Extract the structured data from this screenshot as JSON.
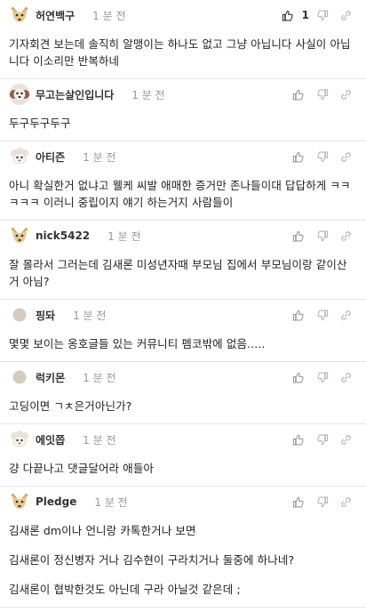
{
  "comments": [
    {
      "nickname": "허연백구",
      "avatar_icon": "dog-face-icon",
      "time": "1 분 전",
      "likes": "1",
      "lines": [
        "기자회견 보는데 솔직히 알맹이는 하나도 없고 그냥 아닙니다 사실이 아닙니다 이소리만 반복하네"
      ]
    },
    {
      "nickname": "무고는살인입니다",
      "avatar_icon": "poodle-face-icon",
      "time": "1 분 전",
      "likes": "",
      "lines": [
        "두구두구두구"
      ]
    },
    {
      "nickname": "아티즌",
      "avatar_icon": "sheep-face-icon",
      "time": "1 분 전",
      "likes": "",
      "lines": [
        "아니 확실한거 없냐고 웰케 씨발 애매한 증거만 존나들이대 답답하게 ㅋㅋㅋㅋㅋ 이러니 중립이지 얘기 하는거지 사람들이"
      ]
    },
    {
      "nickname": "nick5422",
      "avatar_icon": "dog-face-icon",
      "time": "1 분 전",
      "likes": "",
      "lines": [
        "잘 몰라서 그러는데 김새론 미성년자때 부모님 집에서 부모님이랑 같이산거 아님?"
      ]
    },
    {
      "nickname": "핑돠",
      "avatar_icon": "gray-circle-icon",
      "time": "1 분 전",
      "likes": "",
      "lines": [
        "몇몇 보이는 옹호글들 있는 커뮤니티 펨코밖에 없음....."
      ]
    },
    {
      "nickname": "럭키몬",
      "avatar_icon": "gray-circle-icon",
      "time": "1 분 전",
      "likes": "",
      "lines": [
        "고딩이면 ㄱㅊ은거아닌가?"
      ]
    },
    {
      "nickname": "에잇쯥",
      "avatar_icon": "sheep-face-icon",
      "time": "1 분 전",
      "likes": "",
      "lines": [
        "걍 다끝나고 댓글달어라 애들아"
      ]
    },
    {
      "nickname": "Pledge",
      "avatar_icon": "dog-face-icon",
      "time": "1 분 전",
      "likes": "",
      "lines": [
        "김새론 dm이나 언니랑 카톡한거나 보면",
        "김새론이 정신병자 거나 김수현이 구라치거나 둘중에 하나네?",
        "김새론이 협박한것도 아닌데 구라 아닐것 같은데 ;"
      ]
    }
  ]
}
